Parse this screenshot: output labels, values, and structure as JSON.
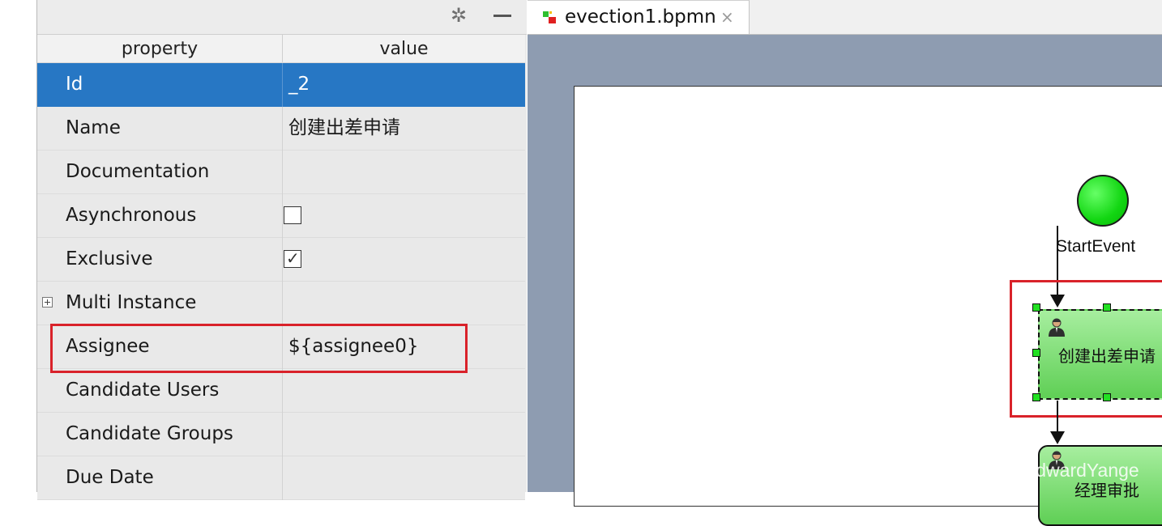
{
  "properties_panel": {
    "headers": {
      "property": "property",
      "value": "value"
    },
    "rows": [
      {
        "property": "Id",
        "value": "_2",
        "selected": true
      },
      {
        "property": "Name",
        "value": "创建出差申请"
      },
      {
        "property": "Documentation",
        "value": ""
      },
      {
        "property": "Asynchronous",
        "checked": false
      },
      {
        "property": "Exclusive",
        "checked": true
      },
      {
        "property": "Multi Instance",
        "value": "",
        "expandable": true
      },
      {
        "property": "Assignee",
        "value": "${assignee0}",
        "highlighted": true
      },
      {
        "property": "Candidate Users",
        "value": ""
      },
      {
        "property": "Candidate Groups",
        "value": ""
      },
      {
        "property": "Due Date",
        "value": ""
      }
    ],
    "toolbar": {
      "settings_icon": "gear-icon",
      "minimize_icon": "minimize-icon"
    }
  },
  "editor": {
    "tab": {
      "label": "evection1.bpmn",
      "close": "×",
      "icon": "bpmn-file-icon"
    },
    "diagram": {
      "start_event_label": "StartEvent",
      "task1_label": "创建出差申请",
      "task2_label": "经理审批"
    }
  },
  "watermark": "CSDN @EdwardYange",
  "colors": {
    "selection": "#2777c4",
    "highlight": "#d9222a",
    "task_fill": "#7fdc76",
    "start_event": "#12d612"
  }
}
